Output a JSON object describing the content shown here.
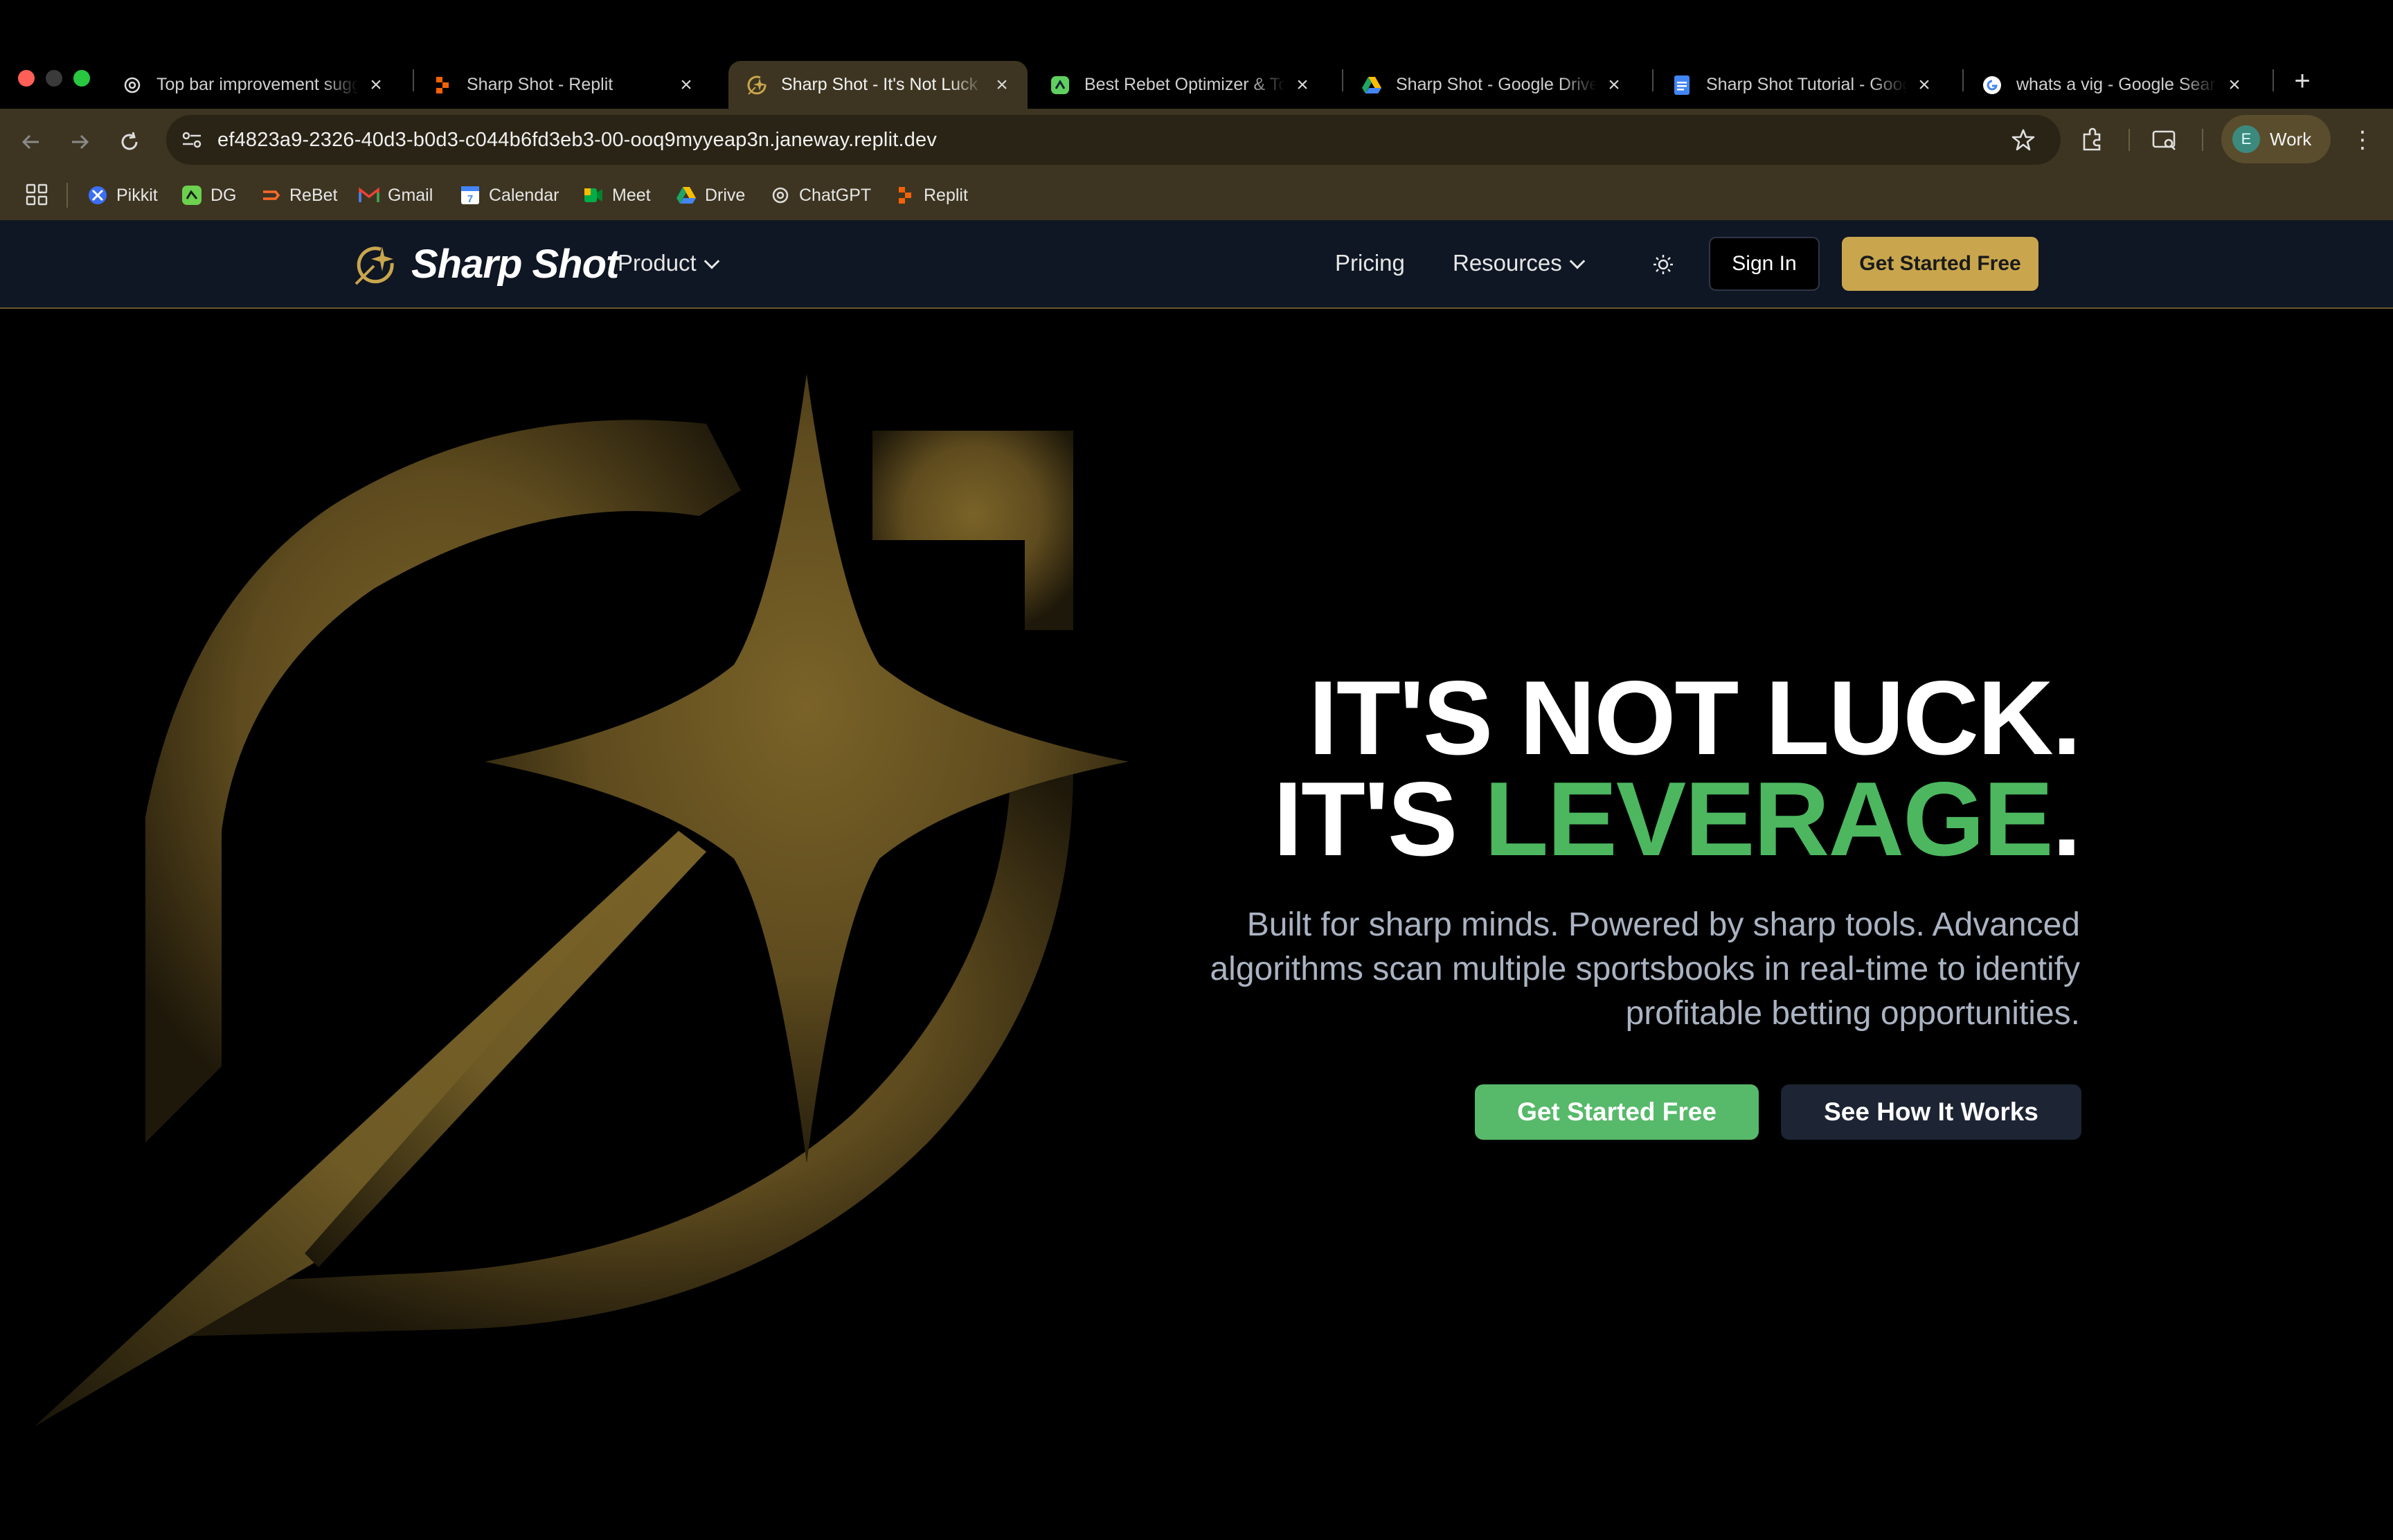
{
  "browser": {
    "tabs": [
      {
        "title": "Top bar improvement sugg",
        "icon": "chatgpt-icon"
      },
      {
        "title": "Sharp Shot - Replit",
        "icon": "replit-icon"
      },
      {
        "title": "Sharp Shot - It's Not Luck",
        "icon": "sharp-shot-icon",
        "active": true
      },
      {
        "title": "Best Rebet Optimizer & To",
        "icon": "rebet-optimizer-icon"
      },
      {
        "title": "Sharp Shot - Google Drive",
        "icon": "google-drive-icon"
      },
      {
        "title": "Sharp Shot Tutorial - Googl",
        "icon": "google-docs-icon"
      },
      {
        "title": "whats a vig - Google Searc",
        "icon": "google-icon"
      }
    ],
    "url": "ef4823a9-2326-40d3-b0d3-c044b6fd3eb3-00-ooq9myyeap3n.janeway.replit.dev",
    "profile": {
      "initial": "E",
      "label": "Work"
    },
    "bookmarks": [
      {
        "label": "Pikkit",
        "icon": "pikkit-icon"
      },
      {
        "label": "DG",
        "icon": "dg-icon"
      },
      {
        "label": "ReBet",
        "icon": "rebet-icon"
      },
      {
        "label": "Gmail",
        "icon": "gmail-icon"
      },
      {
        "label": "Calendar",
        "icon": "calendar-icon"
      },
      {
        "label": "Meet",
        "icon": "meet-icon"
      },
      {
        "label": "Drive",
        "icon": "drive-icon"
      },
      {
        "label": "ChatGPT",
        "icon": "chatgpt-icon"
      },
      {
        "label": "Replit",
        "icon": "replit-icon"
      }
    ]
  },
  "site": {
    "brand": "Sharp Shot",
    "nav": {
      "product": "Product",
      "pricing": "Pricing",
      "resources": "Resources",
      "sign_in": "Sign In",
      "cta": "Get Started Free"
    },
    "hero": {
      "headline_line1": "IT'S NOT LUCK.",
      "headline_line2_prefix": "IT'S ",
      "headline_line2_accent": "LEVERAGE",
      "headline_line2_suffix": ".",
      "subtitle": "Built for sharp minds. Powered by sharp tools. Advanced algorithms scan multiple sportsbooks in real-time to identify profitable betting opportunities.",
      "primary_cta": "Get Started Free",
      "secondary_cta": "See How It Works"
    },
    "colors": {
      "gold": "#c9a64d",
      "green": "#4cb75f",
      "header_bg": "#0f1624"
    }
  }
}
